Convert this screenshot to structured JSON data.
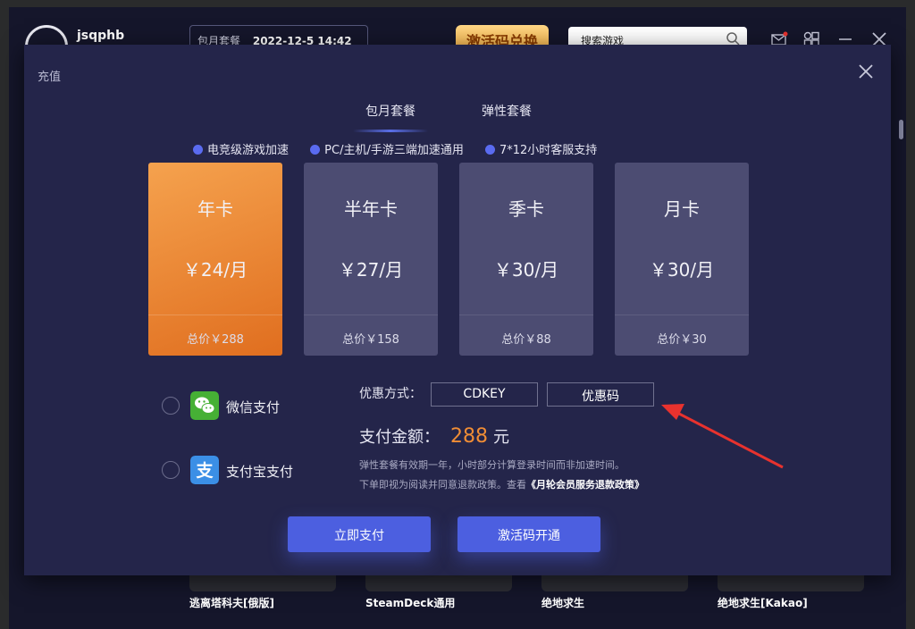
{
  "app": {
    "name": "jsqphb",
    "plan_label": "包月套餐",
    "plan_date": "2022-12-5 14:42",
    "activate_label": "激活码兑换",
    "search_placeholder": "搜索游戏",
    "games": [
      "逃离塔科夫[俄版]",
      "SteamDeck通用",
      "绝地求生",
      "绝地求生[Kakao]"
    ]
  },
  "dialog": {
    "title": "充值",
    "tabs": [
      {
        "label": "包月套餐",
        "active": true
      },
      {
        "label": "弹性套餐",
        "active": false
      }
    ],
    "features": [
      "电竞级游戏加速",
      "PC/主机/手游三端加速通用",
      "7*12小时客服支持"
    ],
    "plans": [
      {
        "name": "年卡",
        "price": "￥24/月",
        "total": "总价￥288",
        "selected": true
      },
      {
        "name": "半年卡",
        "price": "￥27/月",
        "total": "总价￥158",
        "selected": false
      },
      {
        "name": "季卡",
        "price": "￥30/月",
        "total": "总价￥88",
        "selected": false
      },
      {
        "name": "月卡",
        "price": "￥30/月",
        "total": "总价￥30",
        "selected": false
      }
    ],
    "payment_methods": [
      {
        "label": "微信支付",
        "icon": "wechat-icon"
      },
      {
        "label": "支付宝支付",
        "icon": "alipay-icon"
      }
    ],
    "discount": {
      "label": "优惠方式：",
      "options": [
        "CDKEY",
        "优惠码"
      ]
    },
    "amount": {
      "label": "支付金额：",
      "value": "288",
      "unit": "元"
    },
    "notes": {
      "line1": "弹性套餐有效期一年，小时部分计算登录时间而非加速时间。",
      "line2_prefix": "下单即视为阅读并同意退款政策。查看",
      "line2_link": "《月轮会员服务退款政策》"
    },
    "buttons": {
      "pay_now": "立即支付",
      "activate_code": "激活码开通"
    }
  },
  "colors": {
    "dialog_bg": "#24254a",
    "card_bg": "#4c4c72",
    "card_selected_from": "#f5a24e",
    "card_selected_to": "#e06e1f",
    "accent_blue": "#4c5fe0",
    "amount_orange": "#f08d35",
    "annotation_arrow": "#e8322e"
  }
}
